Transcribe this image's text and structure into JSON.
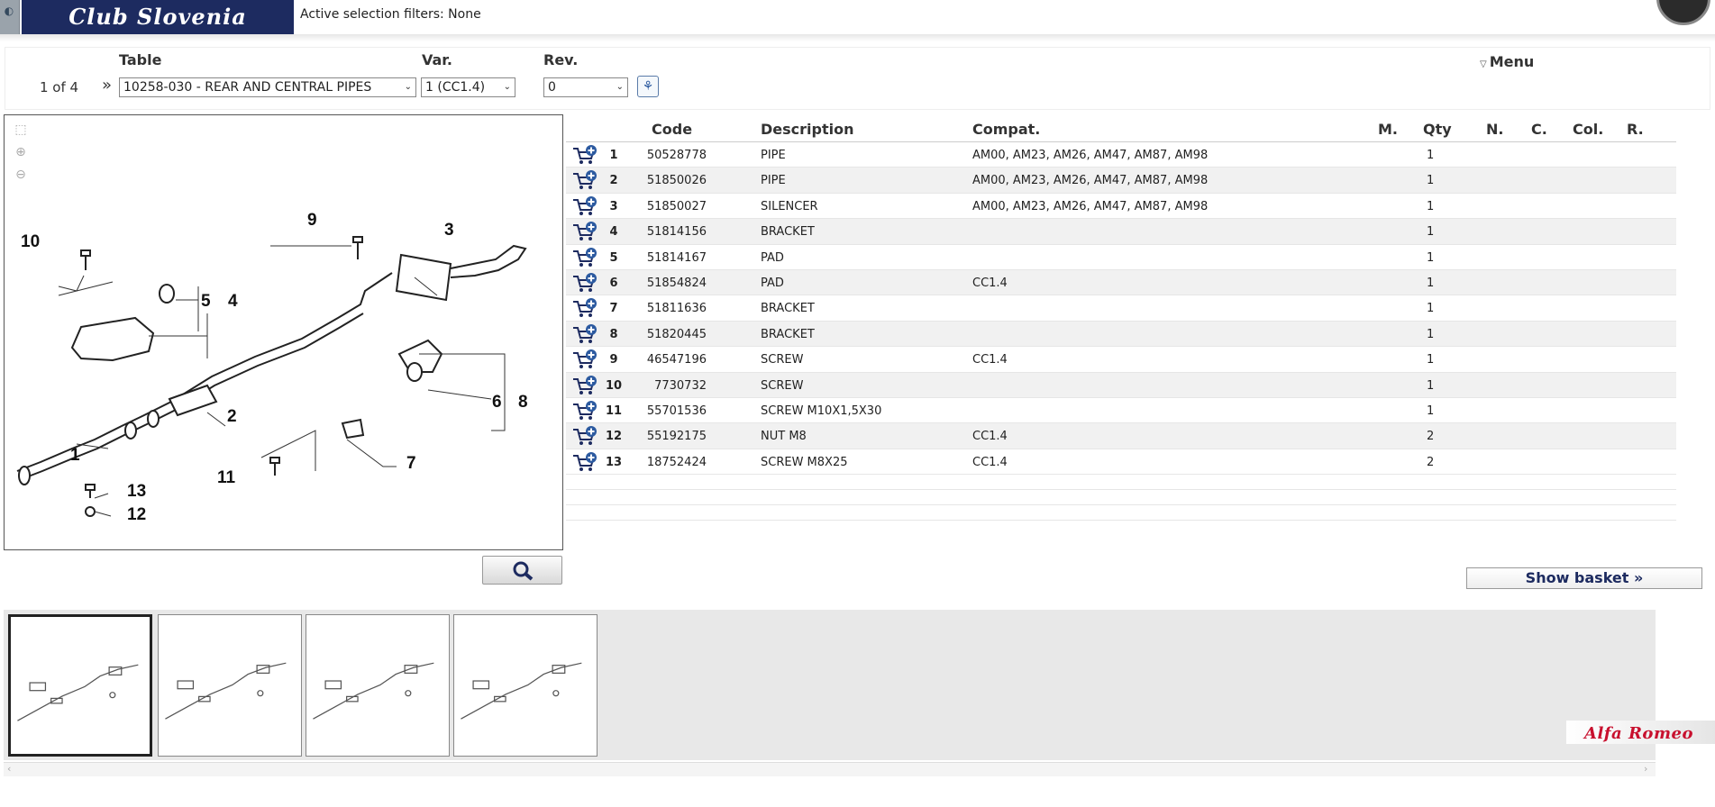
{
  "header": {
    "brand_text": "Club Slovenia",
    "filters_text": "Active selection filters: None"
  },
  "controls": {
    "table_label": "Table",
    "var_label": "Var.",
    "rev_label": "Rev.",
    "page_info": "1 of 4",
    "table_value": "10258-030 - REAR AND CENTRAL PIPES",
    "var_value": "1 (CC1.4)",
    "rev_value": "0",
    "menu_label": "Menu"
  },
  "table": {
    "headers": [
      "Code",
      "Description",
      "Compat.",
      "M.",
      "Qty",
      "N.",
      "C.",
      "Col.",
      "R."
    ],
    "rows": [
      {
        "num": "1",
        "code": "50528778",
        "desc": "PIPE",
        "compat": "AM00, AM23, AM26, AM47, AM87, AM98",
        "qty": "1"
      },
      {
        "num": "2",
        "code": "51850026",
        "desc": "PIPE",
        "compat": "AM00, AM23, AM26, AM47, AM87, AM98",
        "qty": "1"
      },
      {
        "num": "3",
        "code": "51850027",
        "desc": "SILENCER",
        "compat": "AM00, AM23, AM26, AM47, AM87, AM98",
        "qty": "1"
      },
      {
        "num": "4",
        "code": "51814156",
        "desc": "BRACKET",
        "compat": "",
        "qty": "1"
      },
      {
        "num": "5",
        "code": "51814167",
        "desc": "PAD",
        "compat": "",
        "qty": "1"
      },
      {
        "num": "6",
        "code": "51854824",
        "desc": "PAD",
        "compat": "CC1.4",
        "qty": "1"
      },
      {
        "num": "7",
        "code": "51811636",
        "desc": "BRACKET",
        "compat": "",
        "qty": "1"
      },
      {
        "num": "8",
        "code": "51820445",
        "desc": "BRACKET",
        "compat": "",
        "qty": "1"
      },
      {
        "num": "9",
        "code": "46547196",
        "desc": "SCREW",
        "compat": "CC1.4",
        "qty": "1"
      },
      {
        "num": "10",
        "code": "7730732",
        "desc": "SCREW",
        "compat": "",
        "qty": "1"
      },
      {
        "num": "11",
        "code": "55701536",
        "desc": "SCREW M10X1,5X30",
        "compat": "",
        "qty": "1"
      },
      {
        "num": "12",
        "code": "55192175",
        "desc": "NUT M8",
        "compat": "CC1.4",
        "qty": "2"
      },
      {
        "num": "13",
        "code": "18752424",
        "desc": "SCREW M8X25",
        "compat": "CC1.4",
        "qty": "2"
      }
    ]
  },
  "diagram_labels": [
    "1",
    "2",
    "3",
    "4",
    "5",
    "6",
    "7",
    "8",
    "9",
    "10",
    "11",
    "12",
    "13"
  ],
  "basket_label": "Show basket »",
  "footer_brand": "Alfa Romeo",
  "colors": {
    "brand_navy": "#1d2b60",
    "alfa_red": "#c8102e",
    "row_alt": "#f1f1f1"
  },
  "icons": [
    "fit-icon",
    "zoom-in-icon",
    "zoom-out-icon",
    "search-icon",
    "cart-add-icon",
    "bulb-icon",
    "menu-triangle-icon",
    "double-chevron-icon"
  ]
}
